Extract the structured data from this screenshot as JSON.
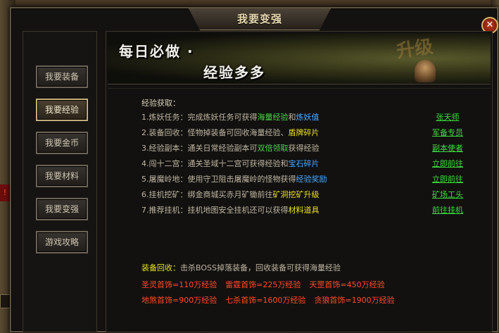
{
  "window": {
    "title": "我要变强",
    "close_symbol": "✕"
  },
  "side_warn": "!",
  "nav": [
    {
      "label": "我要装备",
      "active": false
    },
    {
      "label": "我要经验",
      "active": true
    },
    {
      "label": "我要金币",
      "active": false
    },
    {
      "label": "我要材料",
      "active": false
    },
    {
      "label": "我要变强",
      "active": false
    },
    {
      "label": "游戏攻略",
      "active": false
    }
  ],
  "banner": {
    "line1": "每日必做 ·",
    "line2": "经验多多",
    "deco": "升级"
  },
  "section_title": "经验获取：",
  "tasks": [
    {
      "name": "1.炼妖任务：",
      "desc_a": "完成炼妖任务可获得",
      "hl1": "海量经验",
      "mid": "和",
      "hl2": "炼妖值",
      "desc_b": "",
      "link": "张天师"
    },
    {
      "name": "2.装备回收：",
      "desc_a": "怪物掉装备可回收海量经验、",
      "hl1": "盾牌碎片",
      "mid": "",
      "hl2": "",
      "desc_b": "",
      "link": "军备专员"
    },
    {
      "name": "3.经验副本：",
      "desc_a": "通关日常经验副本可",
      "hl1": "双倍领取",
      "mid": "获得经验",
      "hl2": "",
      "desc_b": "",
      "link": "副本使者"
    },
    {
      "name": "4.闯十二宫：",
      "desc_a": "通关圣域十二宫可获得经验和",
      "hl1": "宝石碎片",
      "mid": "",
      "hl2": "",
      "desc_b": "",
      "link": "立即前往"
    },
    {
      "name": "5.屠魔岭地：",
      "desc_a": "使用守卫阻击屠魔岭的怪物获得",
      "hl1": "经验奖励",
      "mid": "",
      "hl2": "",
      "desc_b": "",
      "link": "立即前往"
    },
    {
      "name": "6.挂机挖矿：",
      "desc_a": "绑金商城买赤月矿锄前往",
      "hl1": "矿洞挖矿升级",
      "mid": "",
      "hl2": "",
      "desc_b": "",
      "link": "矿场工头"
    },
    {
      "name": "7.推荐挂机：",
      "desc_a": "挂机地图安全挂机还可以获得",
      "hl1": "材料道具",
      "mid": "",
      "hl2": "",
      "desc_b": "",
      "link": "前往挂机"
    }
  ],
  "recycle": {
    "label": "装备回收：",
    "text": "击杀BOSS掉落装备，回收装备可获得海量经验"
  },
  "bonus_rows": [
    [
      "圣灵首饰=110万经验",
      "雷霆首饰=225万经验",
      "天罡首饰=450万经验"
    ],
    [
      "地煞首饰=900万经验",
      "七杀首饰=1600万经验",
      "贪狼首饰=1900万经验"
    ]
  ],
  "colors": {
    "highlight_yellow": "#e8e020",
    "highlight_blue": "#4aa8ff",
    "link_green": "#3edc3e",
    "bonus_red": "#ff4a2a"
  }
}
